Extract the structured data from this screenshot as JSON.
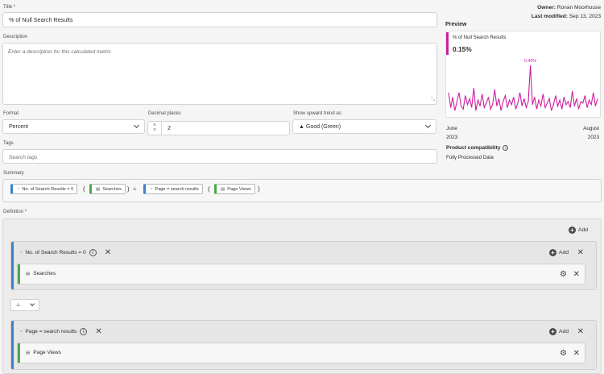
{
  "title_field": {
    "label": "Title",
    "required_mark": "*",
    "value": "% of Null Search Results"
  },
  "description_field": {
    "label": "Description",
    "placeholder": "Enter a description for this calculated metric"
  },
  "format_field": {
    "label": "Format",
    "value": "Percent"
  },
  "decimal_field": {
    "label": "Decimal places",
    "value": "2"
  },
  "trend_field": {
    "label": "Show upward trend as",
    "value": "▲ Good (Green)"
  },
  "tags_field": {
    "label": "Tags",
    "placeholder": "Search tags"
  },
  "meta": {
    "owner_label": "Owner:",
    "owner": "Ronan Moorhouse",
    "modified_label": "Last modified:",
    "modified": "Sep 13, 2023"
  },
  "preview": {
    "heading": "Preview",
    "metric_name": "% of Null Search Results",
    "metric_value": "0.15%",
    "peak_label": "0.40%",
    "accent_color": "#cc1f9f",
    "x_start_month": "June",
    "x_start_year": "2023",
    "x_end_month": "August",
    "x_end_year": "2023"
  },
  "chart_data": {
    "type": "line",
    "series": [
      {
        "values": [
          0.22,
          0.12,
          0.19,
          0.1,
          0.16,
          0.22,
          0.13,
          0.11,
          0.2,
          0.14,
          0.18,
          0.12,
          0.25,
          0.1,
          0.17,
          0.13,
          0.21,
          0.12,
          0.15,
          0.19,
          0.11,
          0.14,
          0.24,
          0.13,
          0.18,
          0.1,
          0.16,
          0.2,
          0.12,
          0.17,
          0.14,
          0.19,
          0.11,
          0.15,
          0.22,
          0.13,
          0.18,
          0.12,
          0.16,
          0.4,
          0.14,
          0.19,
          0.11,
          0.17,
          0.13,
          0.21,
          0.12,
          0.15,
          0.18,
          0.1,
          0.14,
          0.2,
          0.13,
          0.17,
          0.11,
          0.19,
          0.14,
          0.16,
          0.12,
          0.23,
          0.13,
          0.18,
          0.11,
          0.16,
          0.15,
          0.2,
          0.12,
          0.17,
          0.14,
          0.22,
          0.13,
          0.18
        ]
      }
    ],
    "annotations": [
      "0.40%"
    ]
  },
  "compat": {
    "heading": "Product compatibility",
    "info_icon": "info-icon",
    "value": "Fully Processed Data"
  },
  "summary": {
    "label": "Summary",
    "segment1": "No. of Search Results = 0",
    "metric1": "Searches",
    "operator": "÷",
    "segment2": "Page = search results",
    "metric2": "Page Views",
    "open_paren": "(",
    "close_paren": ")"
  },
  "definition": {
    "label": "Definition",
    "required_mark": "*",
    "add_label": "Add",
    "operator_symbol": "÷",
    "container1": {
      "segment": "No. of Search Results = 0",
      "metric": "Searches",
      "add_label": "Add"
    },
    "container2": {
      "segment": "Page = search results",
      "metric": "Page Views",
      "add_label": "Add"
    }
  }
}
